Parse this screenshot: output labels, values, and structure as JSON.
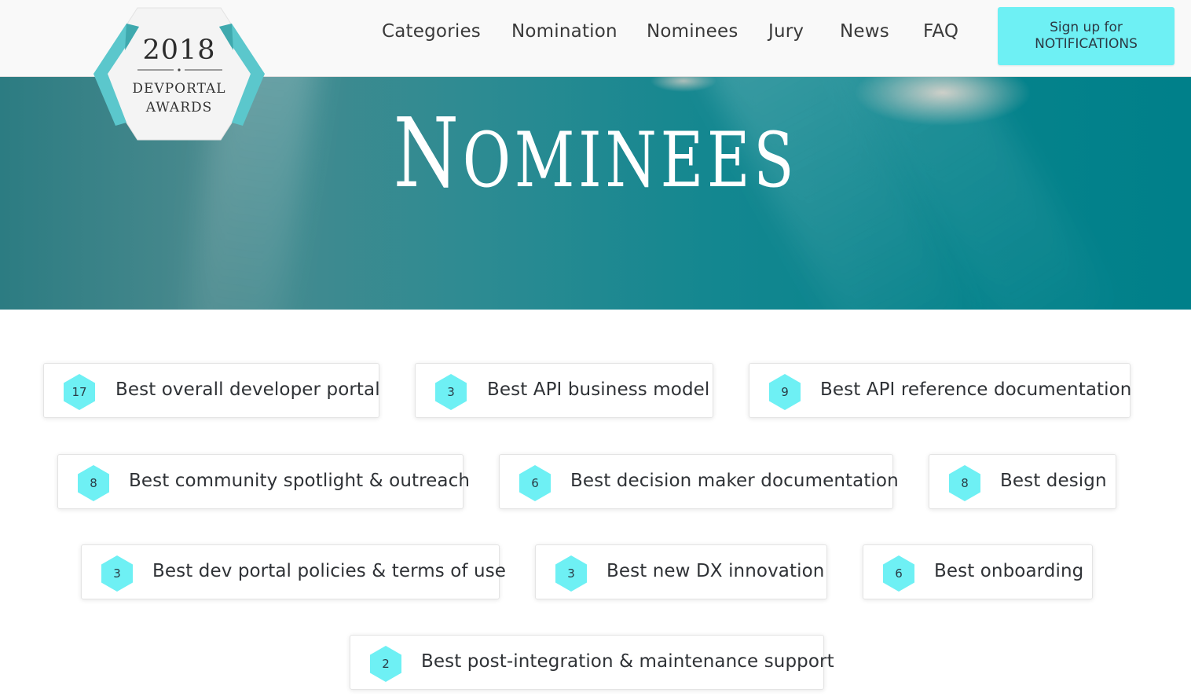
{
  "logo": {
    "year": "2018",
    "line1": "DEVPORTAL",
    "line2": "AWARDS"
  },
  "nav": {
    "items": [
      "Categories",
      "Nomination",
      "Nominees",
      "Jury",
      "News",
      "FAQ"
    ],
    "signup_line1": "Sign up for",
    "signup_line2": "NOTIFICATIONS"
  },
  "hero": {
    "title": "Nominees"
  },
  "categories": [
    {
      "count": "17",
      "label": "Best overall developer portal"
    },
    {
      "count": "3",
      "label": "Best API business model"
    },
    {
      "count": "9",
      "label": "Best API reference documentation"
    },
    {
      "count": "8",
      "label": "Best community spotlight & outreach"
    },
    {
      "count": "6",
      "label": "Best decision maker documentation"
    },
    {
      "count": "8",
      "label": "Best design"
    },
    {
      "count": "3",
      "label": "Best dev portal policies & terms of use"
    },
    {
      "count": "3",
      "label": "Best new DX innovation"
    },
    {
      "count": "6",
      "label": "Best onboarding"
    },
    {
      "count": "2",
      "label": "Best post-integration & maintenance support"
    }
  ],
  "colors": {
    "accent": "#6ef0f4",
    "hero_teal": "#00808a",
    "logo_ribbon": "#5bc7cc"
  }
}
